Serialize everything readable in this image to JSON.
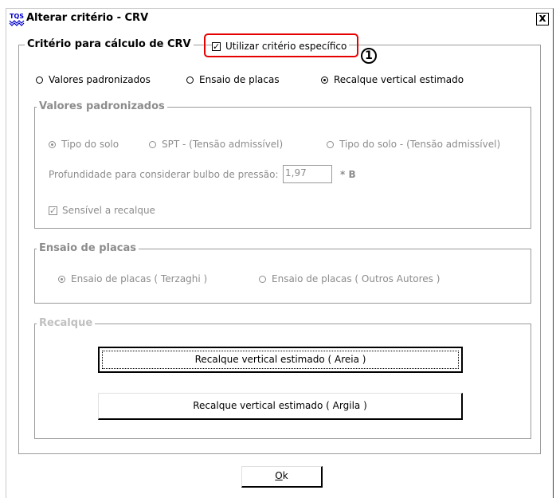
{
  "window": {
    "title": "Alterar critério - CRV",
    "app_icon": "tqs-logo-icon",
    "close_label": "x"
  },
  "criterio": {
    "legend": "Critério para cálculo de CRV",
    "use_specific_label": "Utilizar critério específico",
    "use_specific_checked": true,
    "options": [
      {
        "label": "Valores padronizados",
        "selected": false
      },
      {
        "label": "Ensaio de placas",
        "selected": false
      },
      {
        "label": "Recalque vertical estimado",
        "selected": true
      }
    ]
  },
  "valores": {
    "legend": "Valores padronizados",
    "options": [
      {
        "label": "Tipo do solo",
        "selected": true
      },
      {
        "label": "SPT - (Tensão admissível)",
        "selected": false
      },
      {
        "label": "Tipo do solo - (Tensão admissível)",
        "selected": false
      }
    ],
    "depth_label": "Profundidade para considerar bulbo de pressão:",
    "depth_value": "1,97",
    "depth_unit": "* B",
    "sensitive_label": "Sensível a recalque",
    "sensitive_checked": true
  },
  "ensaio": {
    "legend": "Ensaio de placas",
    "options": [
      {
        "label": "Ensaio de placas ( Terzaghi )",
        "selected": true
      },
      {
        "label": "Ensaio de placas ( Outros Autores )",
        "selected": false
      }
    ]
  },
  "recalque": {
    "legend": "Recalque",
    "areia_button": "Recalque vertical estimado ( Areia )",
    "argila_button": "Recalque vertical estimado ( Argila )"
  },
  "ok_button": {
    "underline": "O",
    "rest": "k"
  },
  "callout": {
    "number": "1",
    "color": "#e60000"
  }
}
